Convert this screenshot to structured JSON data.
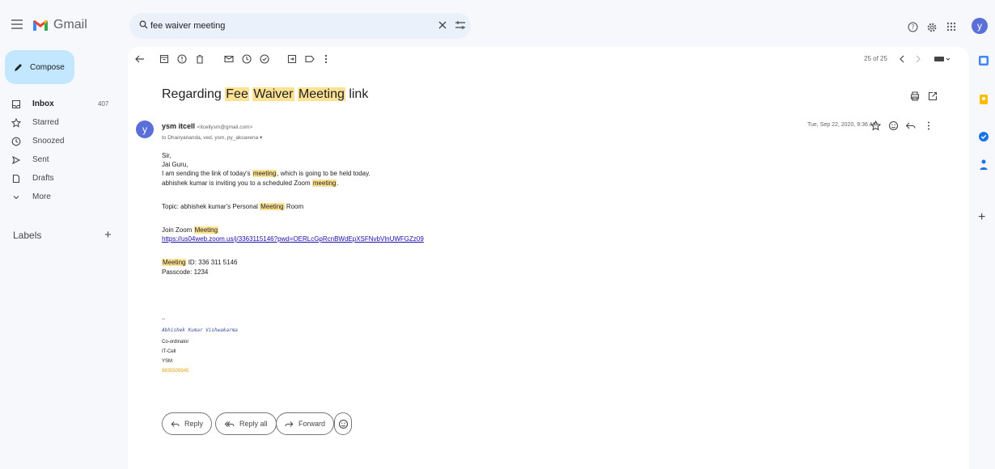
{
  "app": {
    "name": "Gmail"
  },
  "search": {
    "value": "fee waiver meeting"
  },
  "user": {
    "initial": "y"
  },
  "sidebar": {
    "compose": "Compose",
    "items": [
      {
        "label": "Inbox",
        "count": "407"
      },
      {
        "label": "Starred",
        "count": ""
      },
      {
        "label": "Snoozed",
        "count": ""
      },
      {
        "label": "Sent",
        "count": ""
      },
      {
        "label": "Drafts",
        "count": ""
      },
      {
        "label": "More",
        "count": ""
      }
    ],
    "labels_title": "Labels",
    "labels_add": "+"
  },
  "toolbar": {
    "count": "25 of 25"
  },
  "email": {
    "subject": {
      "pre": "Regarding ",
      "h1": "Fee",
      "mid1": " ",
      "h2": "Waiver",
      "mid2": " ",
      "h3": "Meeting",
      "post": " link"
    },
    "sender_initial": "y",
    "sender_name": "ysm itcell",
    "sender_email": "<itcellysm@gmail.com>",
    "to": "to Dhairyananda, ved, ysm, py_aksaxena ▾",
    "date": "Tue, Sep 22, 2020, 9:36 AM",
    "body": {
      "greeting": "Sir,",
      "jai": "Jai Guru,",
      "l3a": "I am sending the link of today's ",
      "l3h": "meeting",
      "l3b": ", which is going to be held today.",
      "l4a": "abhishek kumar is inviting you to a scheduled Zoom ",
      "l4h": "meeting",
      "l4b": ".",
      "topic_a": "Topic: abhishek kumar's Personal ",
      "topic_h": "Meeting",
      "topic_b": " Room",
      "join_a": "Join Zoom ",
      "join_h": "Meeting",
      "link": "https://us04web.zoom.us/j/3363115146?pwd=OERLcGpRcnBWdEpXSFNvbVlnUWFGZz09",
      "mid_h": "Meeting",
      "mid_b": " ID: 336 311 5146",
      "passcode": "Passcode: 1234"
    },
    "signature": {
      "dashes": "--",
      "name": "Abhishek Kumar Vishwakarma",
      "title": "Co-ordinator",
      "dept": "IT-Cell",
      "org": "YSM",
      "phone": "9835509945"
    }
  },
  "actions": {
    "reply": "Reply",
    "reply_all": "Reply all",
    "forward": "Forward"
  },
  "colors": {
    "compose_bg": "#c2e7ff",
    "highlight": "#fde293",
    "avatar": "#5b6fd8",
    "link": "#1a0dab"
  }
}
